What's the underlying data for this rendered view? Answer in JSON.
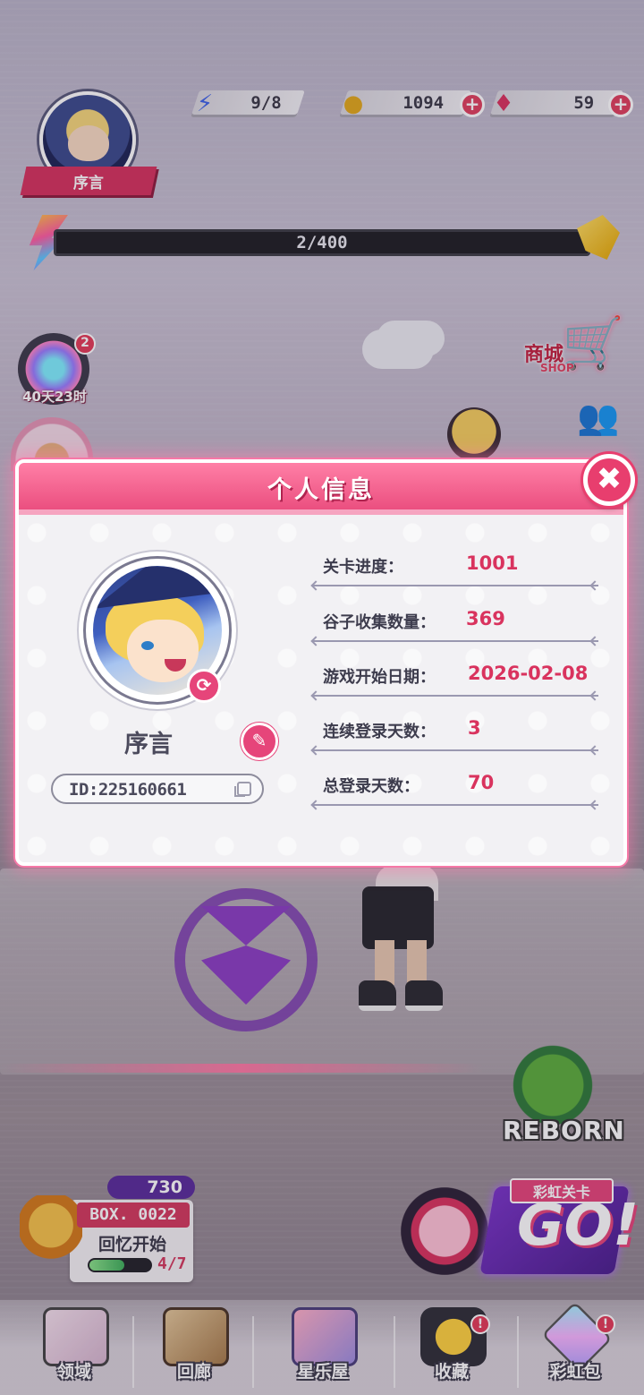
{
  "top_bar": {
    "energy": "9/8",
    "coins": "1094",
    "gems": "59",
    "plus_symbol": "+"
  },
  "player_badge": {
    "name": "序言"
  },
  "xp_bar": {
    "progress_text": "2/400",
    "progress_fraction": 0.005
  },
  "event": {
    "badge_count": "2",
    "timer": "40天23时"
  },
  "shop": {
    "label_cn": "商城",
    "label_en": "SHOP"
  },
  "modal": {
    "title": "个人信息",
    "close_symbol": "✖",
    "player_name": "序言",
    "player_id": "ID:225160661",
    "stats": [
      {
        "label": "关卡进度：",
        "value": "1001"
      },
      {
        "label": "谷子收集数量：",
        "value": "369"
      },
      {
        "label": "游戏开始日期：",
        "value": "2026-02-08"
      },
      {
        "label": "连续登录天数：",
        "value": "3"
      },
      {
        "label": "总登录天数：",
        "value": "70"
      }
    ]
  },
  "reborn": {
    "label": "REBORN"
  },
  "box_card": {
    "gems": "730",
    "title": "BOX. 0022",
    "subtitle": "回忆开始",
    "count": "4/7",
    "progress_fraction": 0.57
  },
  "rainbow_stage": {
    "label": "彩虹关卡",
    "go": "GO!"
  },
  "bottom_nav": {
    "items": [
      {
        "label": "领域",
        "icon": "domain-icon",
        "alert": ""
      },
      {
        "label": "回廊",
        "icon": "gallery-icon",
        "alert": ""
      },
      {
        "label": "星乐屋",
        "icon": "star-house-icon",
        "alert": ""
      },
      {
        "label": "收藏",
        "icon": "star-icon",
        "alert": "!"
      },
      {
        "label": "彩虹包",
        "icon": "rainbow-pack-icon",
        "alert": "!"
      }
    ]
  },
  "colors": {
    "accent": "#e6457a",
    "value_text": "#d9335e",
    "modal_bg": "#f2f1f4"
  }
}
